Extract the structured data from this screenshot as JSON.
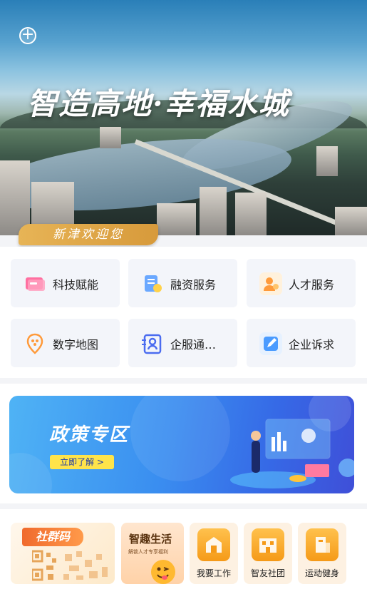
{
  "banner": {
    "title": "智造高地·幸福水城",
    "welcome": "新津欢迎您"
  },
  "services": [
    {
      "label": "科技赋能",
      "icon": "tech-card-icon"
    },
    {
      "label": "融资服务",
      "icon": "finance-document-icon"
    },
    {
      "label": "人才服务",
      "icon": "talent-person-icon"
    },
    {
      "label": "数字地图",
      "icon": "map-pin-icon"
    },
    {
      "label": "企服通…",
      "icon": "enterprise-id-icon"
    },
    {
      "label": "企业诉求",
      "icon": "edit-request-icon"
    }
  ],
  "policy": {
    "title": "政策专区",
    "button": "立即了解 >"
  },
  "bottom": {
    "qr": {
      "tag": "社群码"
    },
    "fun": {
      "title": "智趣生活",
      "subtitle": "解锁人才专享福利"
    },
    "items": [
      {
        "label": "我要工作",
        "icon": "work-building-icon"
      },
      {
        "label": "智友社团",
        "icon": "club-building-icon"
      },
      {
        "label": "运动健身",
        "icon": "fitness-building-icon"
      }
    ]
  },
  "colors": {
    "accent_orange": "#f59a18",
    "policy_blue": "#3a8ef0",
    "welcome_gold": "#e7b456"
  }
}
